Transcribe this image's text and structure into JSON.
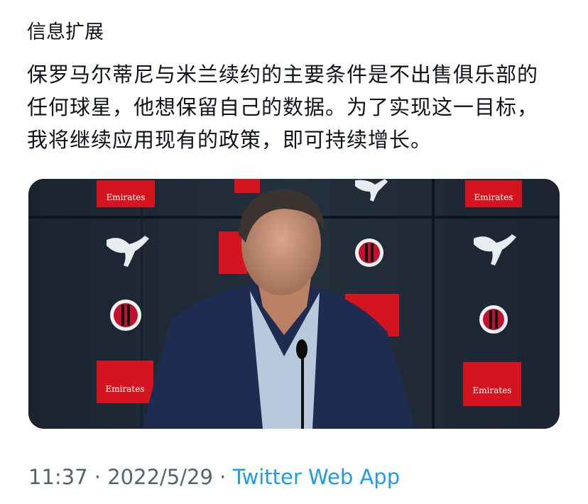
{
  "tweet": {
    "translation_label": "信息扩展",
    "text": "保罗马尔蒂尼与米兰续约的主要条件是不出售俱乐部的任何球星，他想保留自己的数据。为了实现这一目标，我将继续应用现有的政策，即可持续增长。",
    "media": {
      "description_icon": "photo",
      "sponsor_board_text": "Emirates"
    },
    "time": "11:37",
    "separator": "·",
    "date": "2022/5/29",
    "source": "Twitter Web App"
  }
}
